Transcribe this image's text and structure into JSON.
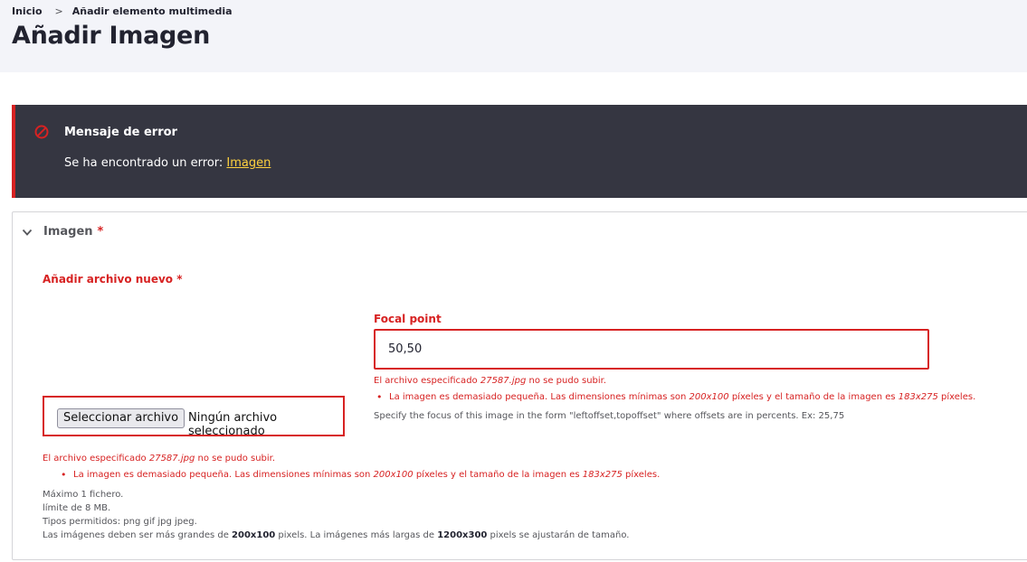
{
  "breadcrumb": {
    "home": "Inicio",
    "separator": ">",
    "current": "Añadir elemento multimedia"
  },
  "page_title": "Añadir Imagen",
  "error": {
    "title": "Mensaje de error",
    "text_prefix": "Se ha encontrado un error: ",
    "link": "Imagen",
    "icon": "error-circle-icon",
    "accent_color": "#d72222",
    "background_color": "#353641"
  },
  "fieldset": {
    "summary": "Imagen",
    "required_mark": "*"
  },
  "new_file": {
    "label": "Añadir archivo nuevo",
    "required_mark": "*"
  },
  "focal": {
    "label": "Focal point",
    "value": "50,50",
    "help": "Specify the focus of this image in the form \"leftoffset,topoffset\" where offsets are in percents. Ex: 25,75"
  },
  "upload_error": {
    "line1_prefix": "El archivo especificado ",
    "filename": "27587.jpg",
    "line1_suffix": " no se pudo subir.",
    "li_prefix": "La imagen es demasiado pequeña. Las dimensiones mínimas son ",
    "min_dims": "200x100",
    "li_mid": " píxeles y el tamaño de la imagen es ",
    "img_dims": "183x275",
    "li_suffix": " píxeles."
  },
  "file_input": {
    "button": "Seleccionar archivo",
    "status": "Ningún archivo seleccionado"
  },
  "description": {
    "max_files": "Máximo 1 fichero.",
    "limit": "límite de 8 MB.",
    "types": "Tipos permitidos: png gif jpg jpeg.",
    "dims_prefix": "Las imágenes deben ser más grandes de ",
    "min": "200x100",
    "dims_mid": " pixels. La imágenes más largas de ",
    "max": "1200x300",
    "dims_suffix": " pixels se ajustarán de tamaño."
  }
}
